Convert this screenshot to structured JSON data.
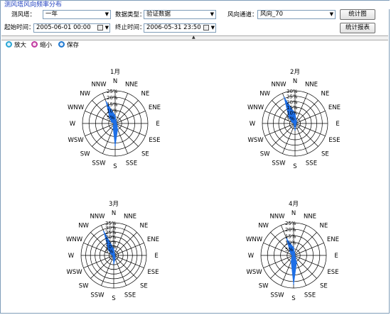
{
  "window_title": "测风塔风向频率分布",
  "filters": {
    "tower_label": "测风塔：",
    "tower_value": "一年",
    "data_type_label": "数据类型：",
    "data_type_value": "验证数据",
    "channel_label": "风向通道：",
    "channel_value": "风向_70",
    "start_label": "起始时间：",
    "start_value": "2005-06-01 00:00",
    "end_label": "终止时间：",
    "end_value": "2006-05-31 23:50"
  },
  "buttons": {
    "stats_chart": "统计图",
    "stats_report": "统计报表"
  },
  "toolbar": {
    "zoom_in": "放大",
    "zoom_out": "缩小",
    "save": "保存"
  },
  "directions": [
    "N",
    "NNE",
    "NE",
    "ENE",
    "E",
    "ESE",
    "SE",
    "SSE",
    "S",
    "SSW",
    "SW",
    "WSW",
    "W",
    "WNW",
    "NW",
    "NNW"
  ],
  "colors": {
    "rose_fill": "#1e6fe6",
    "grid": "#000000",
    "title_text": "#1f3fbf"
  },
  "chart_data": [
    {
      "type": "radar",
      "title": "1月",
      "rmax": 25,
      "ring_labels": [
        "5%",
        "10%",
        "15%",
        "20%",
        "25%"
      ],
      "categories": [
        "N",
        "NNE",
        "NE",
        "ENE",
        "E",
        "ESE",
        "SE",
        "SSE",
        "S",
        "SSW",
        "SW",
        "WSW",
        "W",
        "WNW",
        "NW",
        "NNW"
      ],
      "values": [
        6,
        2,
        1,
        1,
        1,
        1,
        2,
        5,
        17,
        4,
        2,
        1,
        1,
        3,
        6,
        18
      ]
    },
    {
      "type": "radar",
      "title": "2月",
      "rmax": 30,
      "ring_labels": [
        "5%",
        "10%",
        "15%",
        "20%",
        "25%",
        "30%"
      ],
      "categories": [
        "N",
        "NNE",
        "NE",
        "ENE",
        "E",
        "ESE",
        "SE",
        "SSE",
        "S",
        "SSW",
        "SW",
        "WSW",
        "W",
        "WNW",
        "NW",
        "NNW"
      ],
      "values": [
        9,
        3,
        2,
        1,
        1,
        1,
        1,
        2,
        6,
        2,
        1,
        1,
        1,
        3,
        8,
        26
      ]
    },
    {
      "type": "radar",
      "title": "3月",
      "rmax": 35,
      "ring_labels": [
        "5%",
        "10%",
        "15%",
        "20%",
        "25%",
        "30%",
        "35%"
      ],
      "categories": [
        "N",
        "NNE",
        "NE",
        "ENE",
        "E",
        "ESE",
        "SE",
        "SSE",
        "S",
        "SSW",
        "SW",
        "WSW",
        "W",
        "WNW",
        "NW",
        "NNW"
      ],
      "values": [
        7,
        2,
        1,
        1,
        1,
        1,
        2,
        4,
        9,
        2,
        1,
        1,
        1,
        3,
        8,
        28
      ]
    },
    {
      "type": "radar",
      "title": "4月",
      "rmax": 25,
      "ring_labels": [
        "5%",
        "10%",
        "15%",
        "20%",
        "25%"
      ],
      "categories": [
        "N",
        "NNE",
        "NE",
        "ENE",
        "E",
        "ESE",
        "SE",
        "SSE",
        "S",
        "SSW",
        "SW",
        "WSW",
        "W",
        "WNW",
        "NW",
        "NNW"
      ],
      "values": [
        6,
        2,
        1,
        1,
        1,
        1,
        2,
        6,
        22,
        5,
        2,
        1,
        1,
        2,
        4,
        14
      ]
    }
  ]
}
